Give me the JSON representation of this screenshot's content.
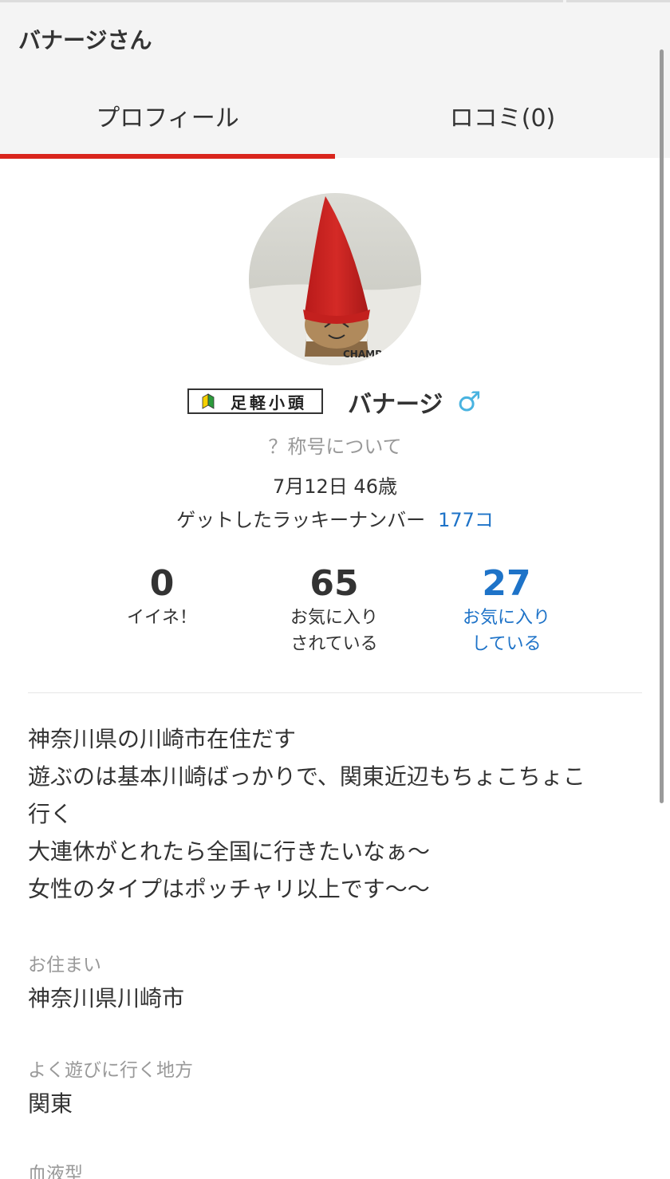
{
  "header": {
    "title": "バナージさん",
    "tabs": [
      {
        "label": "プロフィール",
        "active": true
      },
      {
        "label": "ロコミ(0)",
        "active": false
      }
    ],
    "active_tab_color": "#d9251d"
  },
  "profile": {
    "avatar_icon": "user-avatar-photo",
    "rank_badge": "足軽小頭",
    "rank_icon": "beginner-leaf-icon",
    "name": "バナージ",
    "gender_symbol": "♂",
    "title_link": "？称号について",
    "birthday": "7月12日 46歳",
    "lucky_label": "ゲットしたラッキーナンバー",
    "lucky_count": "177コ",
    "link_color": "#1e73c8"
  },
  "stats": [
    {
      "value": "0",
      "label_lines": [
        "イイネ！"
      ]
    },
    {
      "value": "65",
      "label_lines": [
        "お気に入り",
        "されている"
      ]
    },
    {
      "value": "27",
      "label_lines": [
        "お気に入り",
        "している"
      ]
    }
  ],
  "bio": [
    "神奈川県の川崎市在住だす",
    "遊ぶのは基本川崎ばっかりで、関東近辺もちょこちょこ",
    "行く",
    "大連休がとれたら全国に行きたいなぁ〜",
    "女性のタイプはポッチャリ以上です〜〜"
  ],
  "fields": [
    {
      "label": "お住まい",
      "value": "神奈川県川崎市"
    },
    {
      "label": "よく遊びに行く地方",
      "value": "関東"
    },
    {
      "label": "血液型",
      "value": ""
    }
  ]
}
